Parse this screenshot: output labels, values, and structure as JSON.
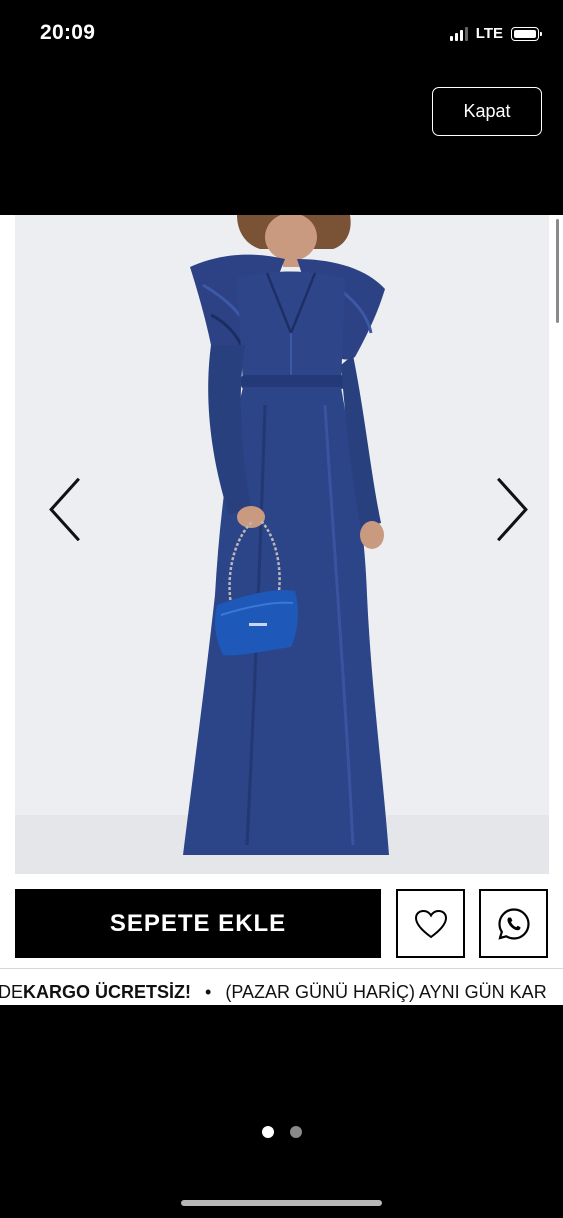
{
  "status_bar": {
    "time": "20:09",
    "network": "LTE"
  },
  "header": {
    "close_label": "Kapat"
  },
  "product": {
    "image_name": "navy satin maxi dress with blue handbag",
    "colors": {
      "dress": "#2a3f80",
      "bag": "#1f55b5",
      "background": "#e9ebee"
    }
  },
  "actions": {
    "add_to_cart_label": "SEPETE EKLE",
    "favorite_icon": "heart-icon",
    "whatsapp_icon": "whatsapp-icon"
  },
  "marquee": {
    "part1": "DE ",
    "part2": "KARGO ÜCRETSİZ!",
    "separator": "•",
    "part3": "(PAZAR GÜNÜ HARİÇ) AYNI GÜN KAR"
  },
  "pager": {
    "current_page": 1,
    "total_pages": 2
  }
}
